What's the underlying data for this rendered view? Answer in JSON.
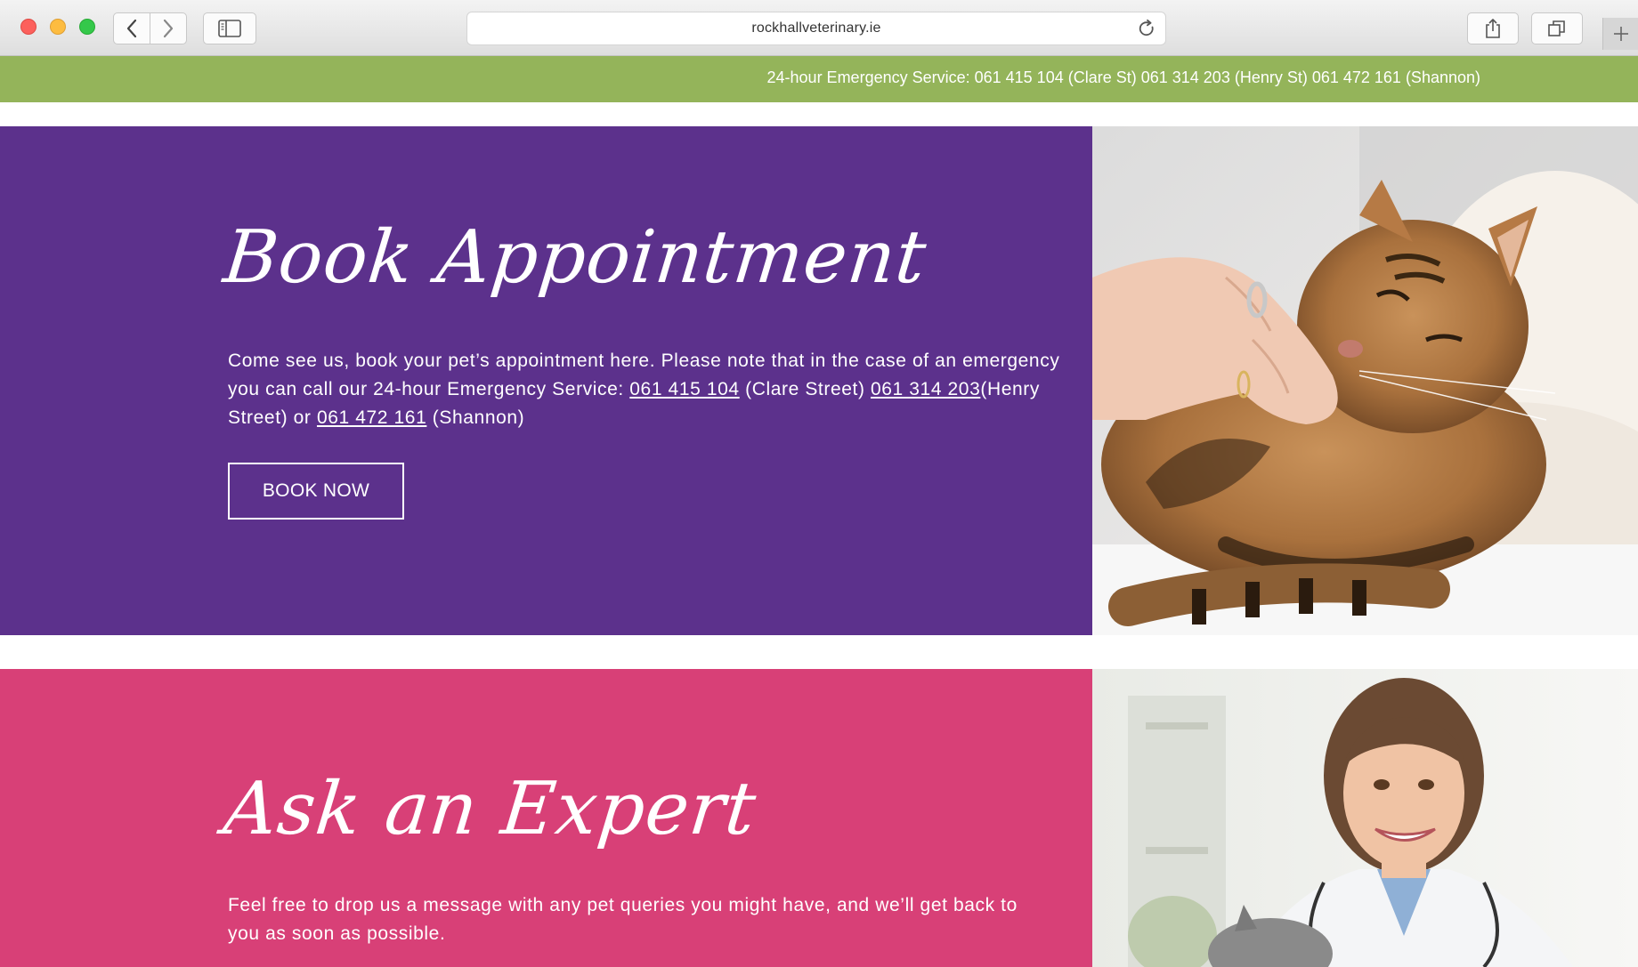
{
  "browser": {
    "url": "rockhallveterinary.ie",
    "icons": [
      "back-arrow-icon",
      "forward-arrow-icon",
      "sidebar-icon",
      "reload-icon",
      "share-icon",
      "tabs-icon",
      "plus-icon"
    ]
  },
  "emergency_bar": {
    "text": "24-hour Emergency Service: 061 415 104 (Clare St) 061 314 203 (Henry St) 061 472 161 (Shannon)",
    "color": "#94b45a"
  },
  "book_section": {
    "title": "Book Appointment",
    "text_intro": "Come see us, book your pet’s appointment here. Please note that in the case of an emergency you can call our 24-hour Emergency Service: ",
    "phone_clare": "061 415 104",
    "label_clare": " (Clare Street) ",
    "phone_henry": "061 314 203",
    "label_henry": "(Henry Street) or ",
    "phone_shannon": "061 472 161",
    "label_shannon": " (Shannon)",
    "button_label": "BOOK NOW",
    "color": "#5c318c",
    "photo_alt": "cat-photo"
  },
  "expert_section": {
    "title": "Ask an Expert",
    "text": "Feel free to drop us a message with any pet queries you might have, and we’ll get back to you as soon as possible.",
    "color": "#d84077",
    "photo_alt": "vet-photo"
  }
}
